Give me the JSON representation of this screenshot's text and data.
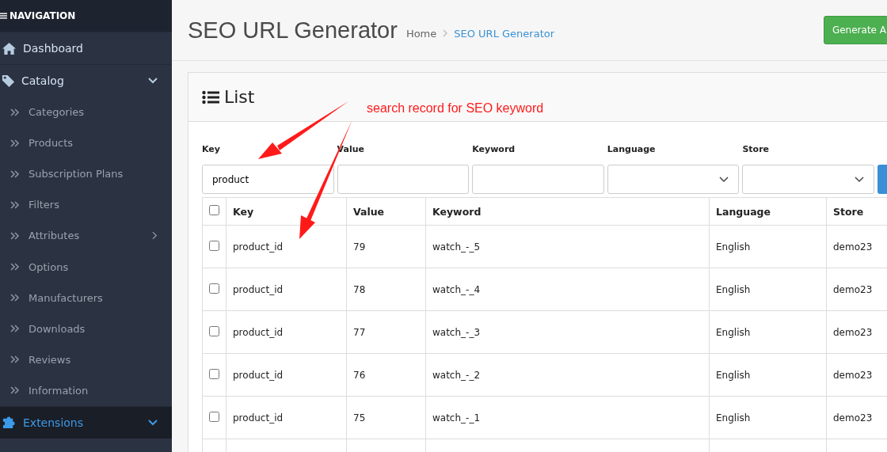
{
  "sidebar": {
    "title": "NAVIGATION",
    "items": [
      {
        "label": "Dashboard",
        "selected": false
      },
      {
        "label": "Catalog",
        "selected": false,
        "expanded": true,
        "children": [
          {
            "label": "Categories"
          },
          {
            "label": "Products"
          },
          {
            "label": "Subscription Plans"
          },
          {
            "label": "Filters"
          },
          {
            "label": "Attributes",
            "expanded": false
          },
          {
            "label": "Options"
          },
          {
            "label": "Manufacturers"
          },
          {
            "label": "Downloads"
          },
          {
            "label": "Reviews"
          },
          {
            "label": "Information"
          }
        ]
      },
      {
        "label": "Extensions",
        "selected": true,
        "expanded": true
      }
    ]
  },
  "header": {
    "title": "SEO URL Generator",
    "breadcrumbs": [
      "Home",
      "SEO URL Generator"
    ],
    "action_button": "Generate A"
  },
  "card": {
    "title": "List",
    "annotation": "search record for SEO keyword",
    "filters": [
      {
        "label": "Key",
        "kind": "text",
        "value": "product"
      },
      {
        "label": "Value",
        "kind": "text"
      },
      {
        "label": "Keyword",
        "kind": "text"
      },
      {
        "label": "Language",
        "kind": "select"
      },
      {
        "label": "Store",
        "kind": "select"
      }
    ],
    "table": {
      "all_checked": false,
      "columns": [
        "Key",
        "Value",
        "Keyword",
        "Language",
        "Store"
      ],
      "rows": [
        {
          "checked": false,
          "cells": [
            "product_id",
            "79",
            "watch_-_5",
            "English",
            "demo23"
          ]
        },
        {
          "checked": false,
          "cells": [
            "product_id",
            "78",
            "watch_-_4",
            "English",
            "demo23"
          ]
        },
        {
          "checked": false,
          "cells": [
            "product_id",
            "77",
            "watch_-_3",
            "English",
            "demo23"
          ]
        },
        {
          "checked": false,
          "cells": [
            "product_id",
            "76",
            "watch_-_2",
            "English",
            "demo23"
          ]
        },
        {
          "checked": false,
          "cells": [
            "product_id",
            "75",
            "watch_-_1",
            "English",
            "demo23"
          ]
        }
      ]
    }
  }
}
